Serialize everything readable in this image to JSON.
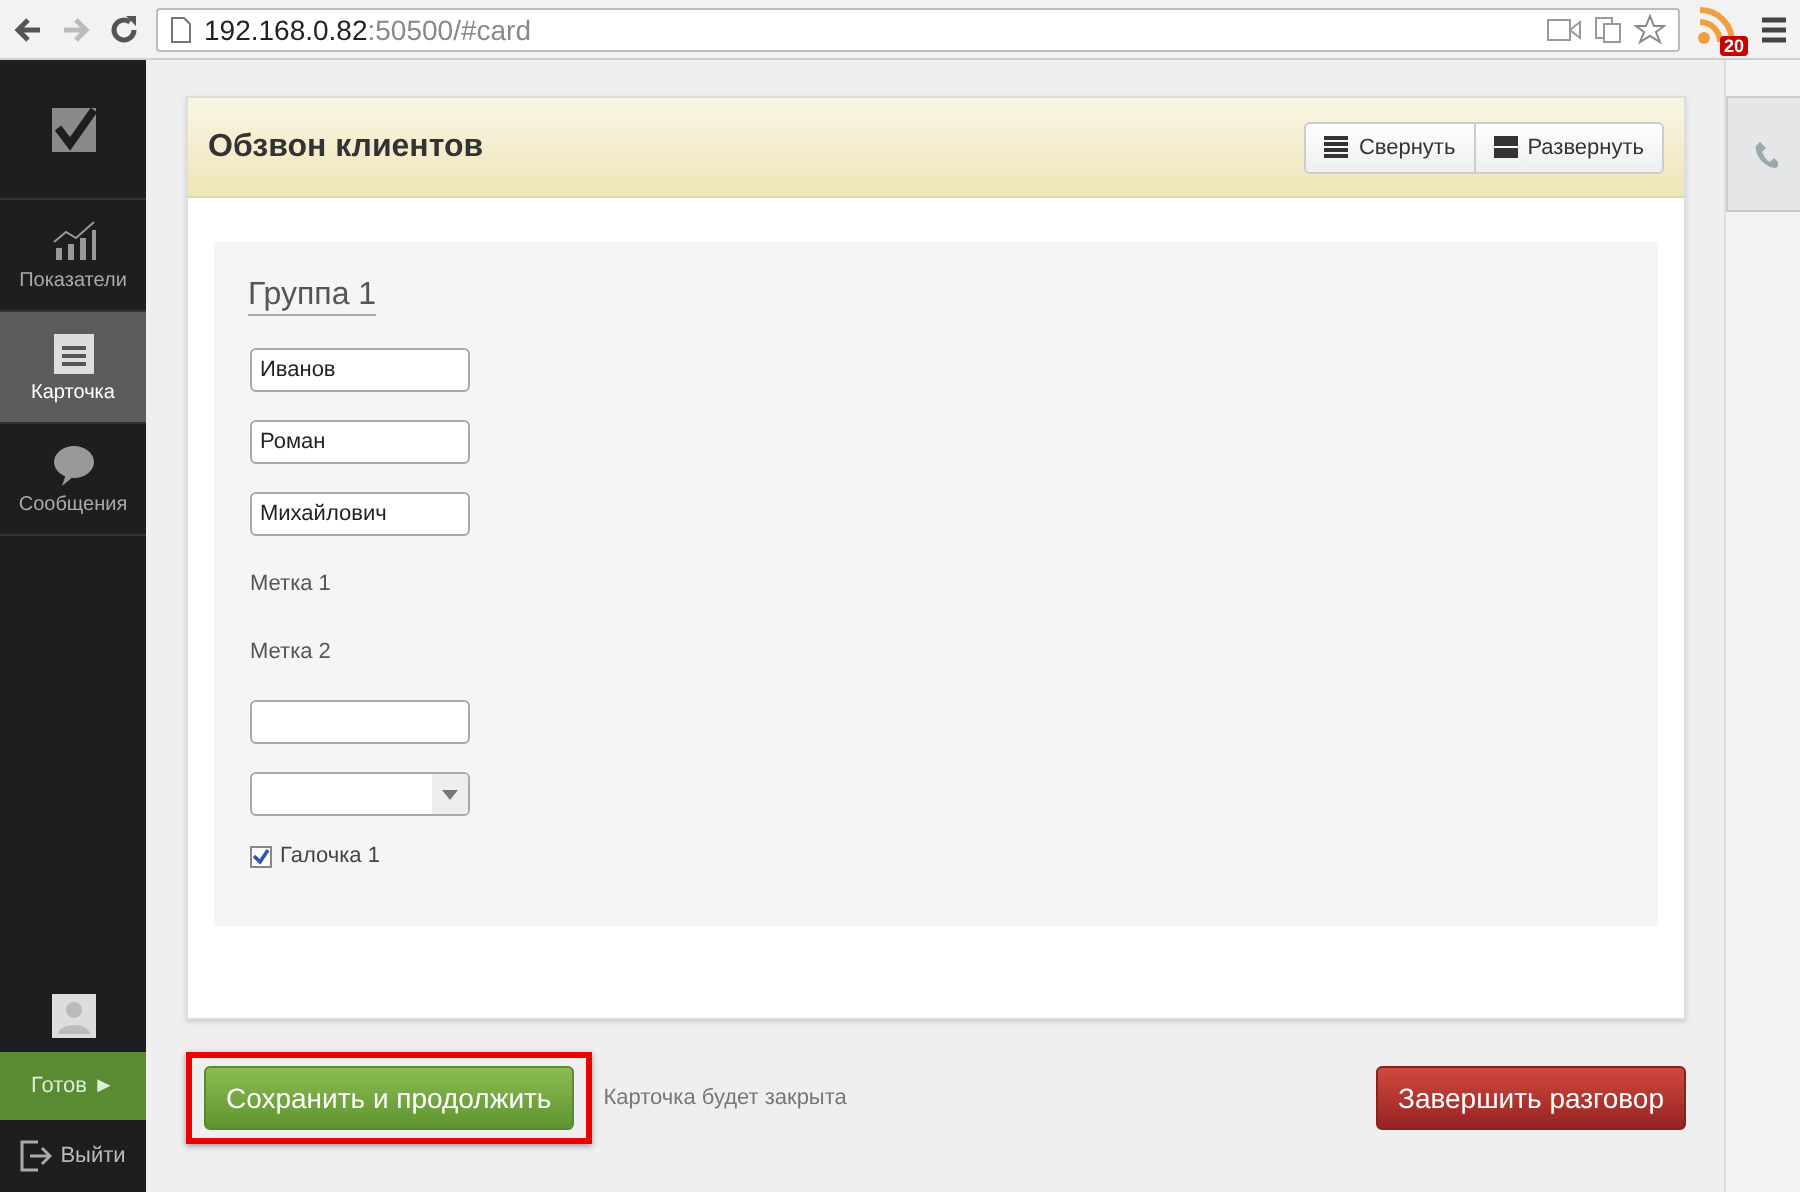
{
  "browser": {
    "host": "192.168.0.82",
    "path": ":50500/#card",
    "badge": "20"
  },
  "sidebar": {
    "items": [
      {
        "label": "Показатели",
        "selected": false
      },
      {
        "label": "Карточка",
        "selected": true
      },
      {
        "label": "Сообщения",
        "selected": false
      }
    ],
    "status": "Готов ►",
    "logout": "Выйти"
  },
  "card": {
    "title": "Обзвон клиентов",
    "buttons": [
      {
        "label": "Свернуть"
      },
      {
        "label": "Развернуть"
      }
    ],
    "group": "Группа 1",
    "fields": [
      {
        "kind": "input",
        "value": "Иванов"
      },
      {
        "kind": "input",
        "value": "Роман"
      },
      {
        "kind": "input",
        "value": "Михайлович"
      },
      {
        "kind": "label",
        "text": "Метка 1"
      },
      {
        "kind": "label",
        "text": "Метка 2"
      },
      {
        "kind": "input"
      },
      {
        "kind": "select"
      },
      {
        "kind": "checkbox",
        "label": "Галочка 1",
        "checked": true
      }
    ]
  },
  "footer": {
    "save": "Сохранить и продолжить",
    "note": "Карточка будет закрыта",
    "finish": "Завершить разговор"
  }
}
